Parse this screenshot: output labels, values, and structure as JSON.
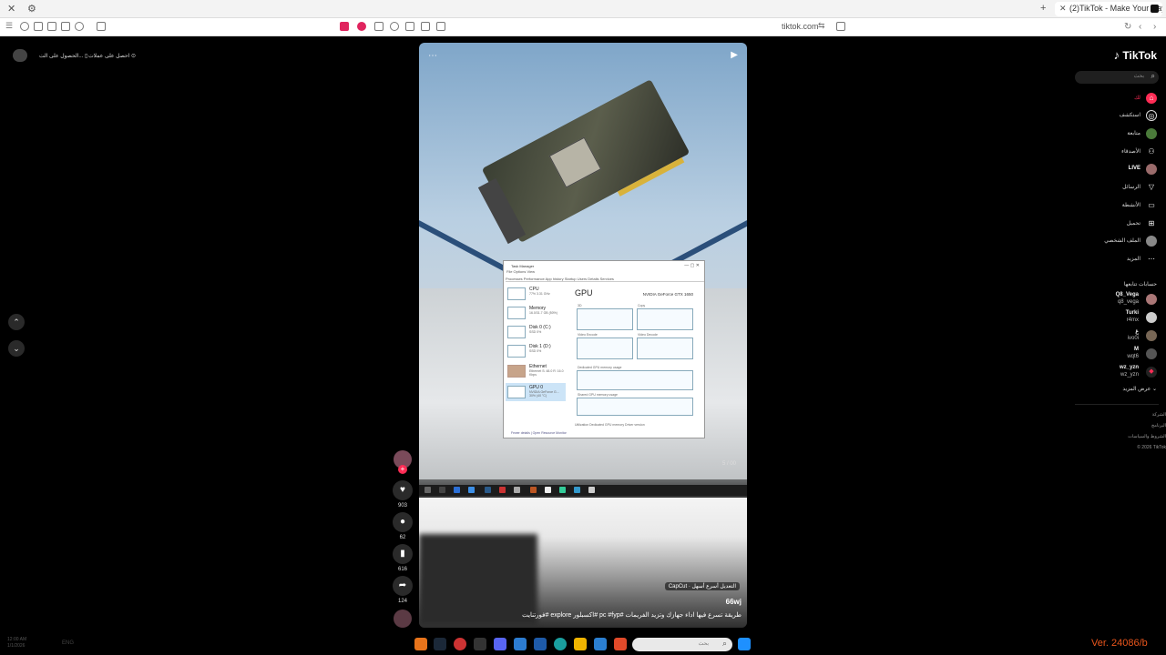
{
  "browser": {
    "tab_title": "(2)TikTok - Make Your Day",
    "url": "tiktok.com",
    "new_tab": "+"
  },
  "top_left": {
    "get_app": "الحصول على الت...",
    "get_coins": "احصل على عملات"
  },
  "video": {
    "menu": "⋯",
    "volume": "▶",
    "task_manager": {
      "title": "Task Manager",
      "menu": "File   Options   View",
      "tabs": "Processes   Performance   App history   Startup   Users   Details   Services",
      "side_items": [
        {
          "name": "CPU",
          "sub": "77% 3.31 GHz"
        },
        {
          "name": "Memory",
          "sub": "16.0/31.7 GB (50%)"
        },
        {
          "name": "Disk 0 (C:)",
          "sub": "SSD\n0%"
        },
        {
          "name": "Disk 1 (D:)",
          "sub": "SSD\n0%"
        },
        {
          "name": "Ethernet",
          "sub": "Ethernet\nS: 48.0 R: 16.0 Kbps"
        },
        {
          "name": "GPU 0",
          "sub": "NVIDIA GeForce G...\n30% (40 °C)"
        }
      ],
      "heading": "GPU",
      "model": "NVIDIA GeForce GTX 1650",
      "graph_labels": [
        "3D",
        "Copy",
        "Video Encode",
        "Video Decode",
        "Dedicated GPU memory usage",
        "Shared GPU memory usage"
      ],
      "stats": "Utilization     Dedicated GPU memory     Driver version",
      "footer": "Fewer details   |   Open Resource Monitor"
    },
    "counter": "5 / 00",
    "capcut_label": "CapCut · التعديل أسرع أسهل",
    "username": "66wj",
    "description": "طريقة تسرع فيها اداء جهازك وتزيد الفريمات #pc #fyp #اكسبلور explore #فورتنايت"
  },
  "actions": {
    "likes": "903",
    "comments": "62",
    "saves": "616",
    "shares": "124"
  },
  "sidebar": {
    "logo": "TikTok",
    "search_placeholder": "بحث",
    "menu": [
      {
        "label": "لك",
        "icon": "home-icon"
      },
      {
        "label": "استكشف",
        "icon": "compass-icon"
      },
      {
        "label": "متابعة",
        "icon": "following-icon"
      },
      {
        "label": "الأصدقاء",
        "icon": "friends-icon"
      },
      {
        "label": "LIVE",
        "icon": "live-icon"
      },
      {
        "label": "الرسائل",
        "icon": "messages-icon"
      },
      {
        "label": "الأنشطة",
        "icon": "activity-icon"
      },
      {
        "label": "تحميل",
        "icon": "upload-icon"
      },
      {
        "label": "الملف الشخصي",
        "icon": "profile-icon"
      },
      {
        "label": "المزيد",
        "icon": "more-icon"
      }
    ],
    "followed_header": "حسابات تتابعها",
    "accounts": [
      {
        "name": "Q8_Vega",
        "handle": "q8_vega"
      },
      {
        "name": "Turki",
        "handle": "r4mx"
      },
      {
        "name": "غ",
        "handle": "ivo0i"
      },
      {
        "name": "M",
        "handle": "wqt6"
      },
      {
        "name": "wz_yzn",
        "handle": "wz_yzn"
      }
    ],
    "see_more": "عرض المزيد",
    "footer": [
      "الشركة",
      "البرنامج",
      "الشروط والسياسات",
      "© 2026 TikTok"
    ]
  },
  "taskbar": {
    "search_placeholder": "بحث",
    "clock_time": "12:00 AM",
    "clock_date": "1/1/2026",
    "lang": "ENG"
  },
  "watermark": "Ver. 24086/b"
}
